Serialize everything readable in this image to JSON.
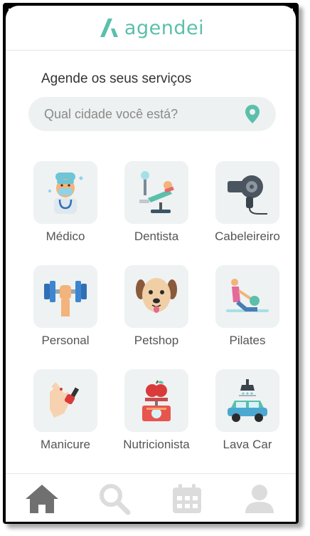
{
  "brand": {
    "name": "agendei",
    "color": "#5bbfab"
  },
  "heading": "Agende os seus serviços",
  "search": {
    "placeholder": "Qual cidade você está?",
    "icon": "location-pin-icon"
  },
  "categories": [
    {
      "label": "Médico",
      "icon": "doctor-icon"
    },
    {
      "label": "Dentista",
      "icon": "dentist-chair-icon"
    },
    {
      "label": "Cabeleireiro",
      "icon": "hair-dryer-icon"
    },
    {
      "label": "Personal",
      "icon": "dumbbell-icon"
    },
    {
      "label": "Petshop",
      "icon": "dog-icon"
    },
    {
      "label": "Pilates",
      "icon": "pilates-icon"
    },
    {
      "label": "Manicure",
      "icon": "nail-polish-icon"
    },
    {
      "label": "Nutricionista",
      "icon": "scale-apple-icon"
    },
    {
      "label": "Lava Car",
      "icon": "car-wash-icon"
    }
  ],
  "bottom_nav": [
    {
      "icon": "home-icon",
      "active": true
    },
    {
      "icon": "search-icon",
      "active": false
    },
    {
      "icon": "calendar-icon",
      "active": false
    },
    {
      "icon": "profile-icon",
      "active": false
    }
  ],
  "colors": {
    "active_nav": "#707070",
    "inactive_nav": "#dcdcdc",
    "tile_bg": "#eef2f2"
  }
}
